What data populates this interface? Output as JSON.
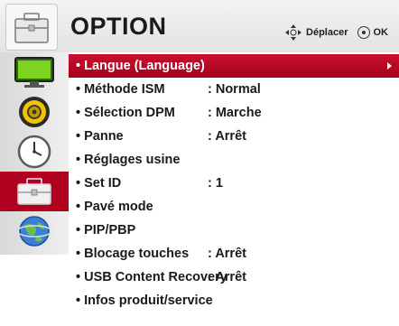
{
  "header": {
    "title": "OPTION",
    "move_hint": "Déplacer",
    "ok_hint": "OK",
    "icon": "toolbox-icon"
  },
  "sidebar": {
    "items": [
      {
        "icon": "picture-monitor-icon"
      },
      {
        "icon": "audio-speaker-icon"
      },
      {
        "icon": "clock-icon"
      },
      {
        "icon": "toolbox-icon",
        "selected": true
      },
      {
        "icon": "network-globe-icon"
      }
    ]
  },
  "menu": {
    "items": [
      {
        "label": "• Langue (Language)",
        "value": ""
      },
      {
        "label": "• Méthode ISM",
        "value": ": Normal"
      },
      {
        "label": "• Sélection DPM",
        "value": ": Marche"
      },
      {
        "label": "• Panne",
        "value": ": Arrêt"
      },
      {
        "label": "• Réglages usine",
        "value": ""
      },
      {
        "label": "• Set ID",
        "value": ": 1"
      },
      {
        "label": "• Pavé mode",
        "value": ""
      },
      {
        "label": "• PIP/PBP",
        "value": ""
      },
      {
        "label": "• Blocage touches",
        "value": ": Arrêt"
      },
      {
        "label": "• USB Content Recovery",
        "value": ": Arrêt"
      },
      {
        "label": "• Infos produit/service",
        "value": ""
      }
    ],
    "selected_index": 0
  },
  "colors": {
    "accent": "#b0001f",
    "text": "#1a1a1a"
  }
}
